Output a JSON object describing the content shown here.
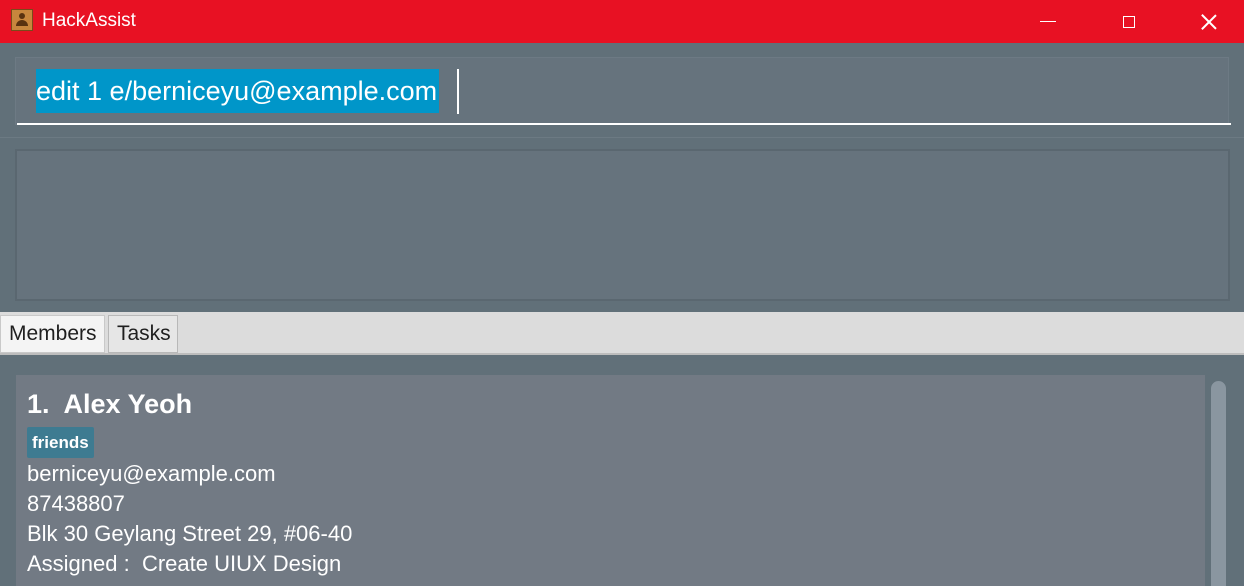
{
  "window": {
    "title": "HackAssist",
    "icon": "address-book-icon",
    "accent_color": "#e81123"
  },
  "command_box": {
    "value": "edit 1 e/berniceyu@example.com",
    "selection_color": "#0096c9"
  },
  "result_display": {
    "text": ""
  },
  "tabs": [
    {
      "label": "Members",
      "selected": true
    },
    {
      "label": "Tasks",
      "selected": false
    }
  ],
  "members": [
    {
      "index_name": "1.  Alex Yeoh",
      "tag": "friends",
      "email": "berniceyu@example.com",
      "phone": "87438807",
      "address": "Blk 30 Geylang Street 29, #06-40",
      "assigned": "Assigned :  Create UIUX Design"
    }
  ]
}
